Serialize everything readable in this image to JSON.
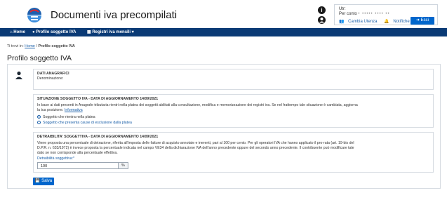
{
  "header": {
    "app_title": "Documenti iva precompilati",
    "info_icon": "i",
    "user_label": "Utr:",
    "user_sub_label": "Per conto",
    "user_sub_value": "• ••••• •••• ••",
    "change_user": "Cambia Utenza",
    "notifications": "Notifiche",
    "exit": "Esci"
  },
  "nav": {
    "home": "Home",
    "profile": "Profilo soggetto IVA",
    "registers": "Registri iva mensili"
  },
  "breadcrumb": {
    "prefix": "Ti trovi in:",
    "home": "Home",
    "sep": "/",
    "current": "Profilo soggetto IVA"
  },
  "page": {
    "title": "Profilo soggetto IVA"
  },
  "dati_anagrafici": {
    "title": "DATI ANAGRAFICI",
    "denominazione_label": "Denominazione:"
  },
  "situazione": {
    "title": "SITUAZIONE SOGGETTO IVA - DATA DI AGGIORNAMENTO 14/09/2021",
    "text_1": "In base ai dati presenti in Anagrafe tributaria rientri nella platea dei soggetti abilitati alla consultazione, modifica e memorizzazione dei registri iva. Se nel frattempo tale situazione è cambiata, aggiorna",
    "text_2_prefix": "la tua posizione.",
    "text_2_link": "Informativa",
    "option_1": "Soggetto che rientra nella platea",
    "option_2": "Soggetto che presenta cause di esclusione dalla platea",
    "selected": "option_1"
  },
  "detraibilita": {
    "title": "DETRAIBILITA' SOGGETTIVA - DATA DI AGGIORNAMENTO 14/09/2021",
    "text_1": "Viene proposta una percentuale di detrazione, riferita all'imposta delle fatture di acquisto annotate e inerenti, pari al 100 per cento. Per gli operatori IVA che hanno applicato il pro-rata (art. 19-bis del",
    "text_2": "D.P.R. n. 633/1972) è invece proposta la percentuale indicata nel campo VE34 della dichiarazione IVA dell'anno precedente oppure del secondo anno precedente. Il contribuente può modificare tale",
    "text_3": "dato se non corrisponde alla percentuale effettiva.",
    "field_label": "Detraibilità soggettiva:*",
    "field_value": "100",
    "field_suffix": "%"
  },
  "actions": {
    "save": "Salva"
  },
  "colors": {
    "nav_bg": "#0a3a75",
    "primary": "#0066cc",
    "link": "#1a5fa8"
  }
}
